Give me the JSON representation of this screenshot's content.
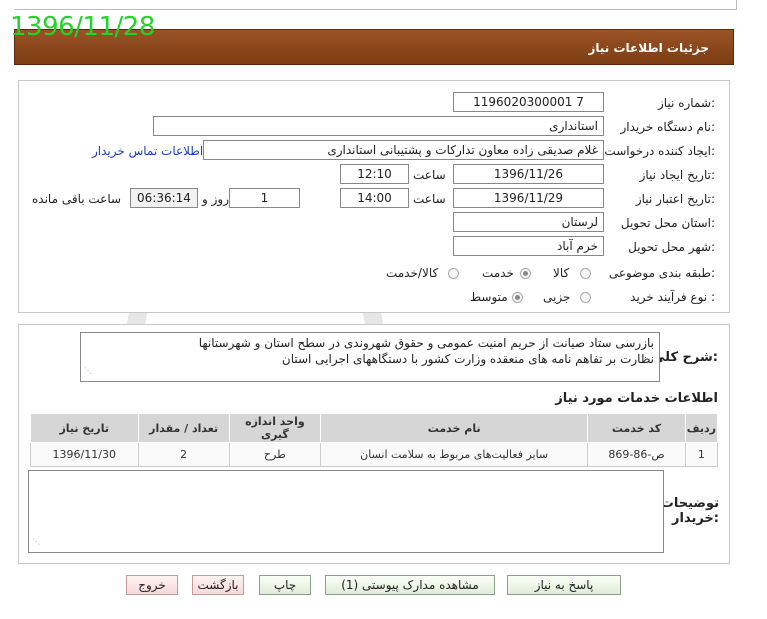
{
  "stamp_date": "1396/11/28",
  "header": {
    "title": "جزئیات اطلاعات نیاز"
  },
  "form": {
    "need_number": {
      "label": "شماره نیاز:",
      "value": "1196020300001 7"
    },
    "buyer_org": {
      "label": "نام دستگاه خریدار:",
      "value": "استانداری"
    },
    "requester": {
      "label": "ایجاد کننده درخواست:",
      "value": "غلام صدیقی زاده معاون تدارکات و پشتیبانی استانداری",
      "contact_link": "اطلاعات تماس خریدار"
    },
    "created": {
      "label": "تاریخ ایجاد نیاز:",
      "date": "1396/11/26",
      "time_label": "ساعت",
      "time": "12:10"
    },
    "validity": {
      "label": "تاریخ اعتبار نیاز:",
      "date": "1396/11/29",
      "time_label": "ساعت",
      "time": "14:00",
      "days": "1",
      "days_label": "روز و",
      "remaining": "06:36:14",
      "remaining_label": "ساعت باقی مانده"
    },
    "province": {
      "label": "استان محل تحویل:",
      "value": "لرستان"
    },
    "city": {
      "label": "شهر محل تحویل:",
      "value": "خرم آباد"
    },
    "category": {
      "label": "طبقه بندی موضوعی:",
      "options": [
        "کالا",
        "خدمت",
        "کالا/خدمت"
      ],
      "selected": "خدمت"
    },
    "process": {
      "label": "نوع فرآیند خرید :",
      "options": [
        "جزیی",
        "متوسط"
      ],
      "selected": "متوسط"
    }
  },
  "general_desc": {
    "label": "شرح کلی نیاز:",
    "line1": "بازرسی ستاد صیانت از حریم امنیت عمومی و حقوق شهروندی در سطح استان و شهرستانها",
    "line2": "نظارت بر تفاهم نامه های منعقده وزارت کشور با دستگاههای اجرایی استان"
  },
  "services": {
    "title": "اطلاعات خدمات مورد نیاز",
    "columns": [
      "ردیف",
      "کد خدمت",
      "نام خدمت",
      "واحد اندازه گیری",
      "تعداد / مقدار",
      "تاریخ نیاز"
    ],
    "rows": [
      {
        "row": "1",
        "code": "ص-86-869",
        "name": "سایر فعالیت‌های مربوط به سلامت انسان",
        "unit": "طرح",
        "qty": "2",
        "date": "1396/11/30"
      }
    ]
  },
  "buyer_notes": {
    "label_line1": "توضیحات",
    "label_line2": "خریدار:",
    "value": ""
  },
  "buttons": {
    "reply": "پاسخ به نیاز",
    "attachments": "مشاهده مدارک پیوستی (1)",
    "print": "چاپ",
    "back": "بازگشت",
    "exit": "خروج"
  }
}
